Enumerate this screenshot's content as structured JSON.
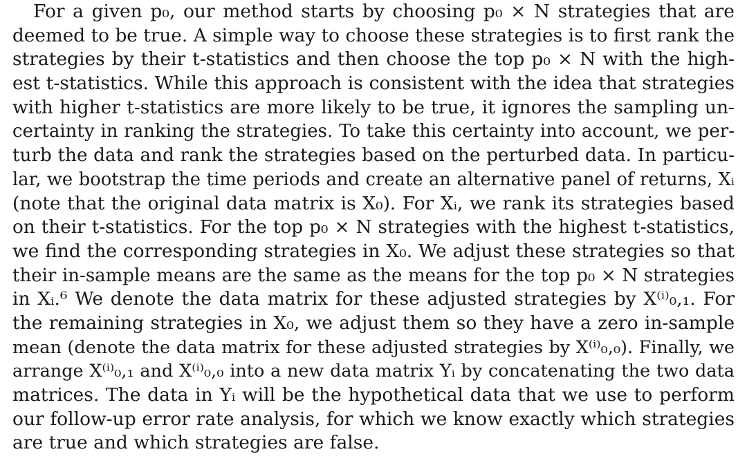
{
  "paragraph": {
    "lines": [
      "For a given p₀, our method starts by choosing p₀ × N strategies that are",
      "deemed to be true. A simple way to choose these strategies is to first rank the",
      "strategies by their t-statistics and then choose the top p₀ × N with the high-",
      "est t-statistics. While this approach is consistent with the idea that strategies",
      "with higher t-statistics are more likely to be true, it ignores the sampling un-",
      "certainty in ranking the strategies. To take this certainty into account, we per-",
      "turb the data and rank the strategies based on the perturbed data. In particu-",
      "lar, we bootstrap the time periods and create an alternative panel of returns, Xᵢ",
      "(note that the original data matrix is X₀). For Xᵢ, we rank its strategies based",
      "on their t-statistics. For the top p₀ × N strategies with the highest t-statistics,",
      "we find the corresponding strategies in X₀. We adjust these strategies so that",
      "their in-sample means are the same as the means for the top p₀ × N strategies",
      "in Xᵢ.⁶ We denote the data matrix for these adjusted strategies by X⁽ⁱ⁾₀,₁. For",
      "the remaining strategies in X₀, we adjust them so they have a zero in-sample",
      "mean (denote the data matrix for these adjusted strategies by X⁽ⁱ⁾₀,₀). Finally, we",
      "arrange X⁽ⁱ⁾₀,₁ and X⁽ⁱ⁾₀,₀ into a new data matrix Yᵢ by concatenating the two data",
      "matrices. The data in Yᵢ will be the hypothetical data that we use to perform",
      "our follow-up error rate analysis, for which we know exactly which strategies",
      "are true and which strategies are false."
    ]
  }
}
